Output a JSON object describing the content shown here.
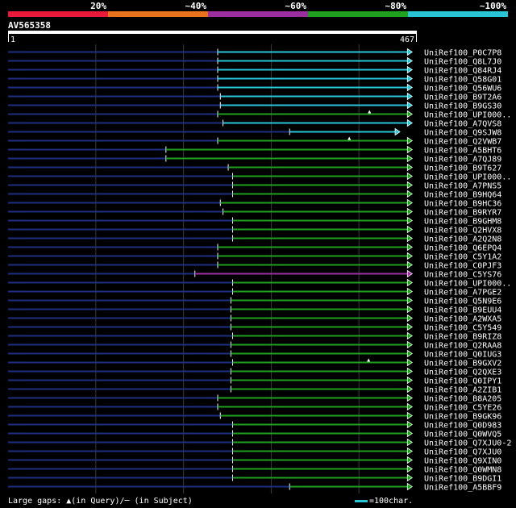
{
  "identity_legend": [
    {
      "label": "20%",
      "color": "#e8193a"
    },
    {
      "label": "~40%",
      "color": "#e8731c"
    },
    {
      "label": "~60%",
      "color": "#9b2fa0"
    },
    {
      "label": "~80%",
      "color": "#1fa01f"
    },
    {
      "label": "~100%",
      "color": "#29c5d6"
    }
  ],
  "query": {
    "name": "AV565358",
    "start_label": "1",
    "end_label": "467"
  },
  "footer": {
    "gaps_text": "Large gaps: ▲(in Query)/─ (in Subject)",
    "scale_text": "=100char."
  },
  "chart_data": {
    "type": "alignment",
    "query_length": 467,
    "hits": [
      {
        "name": "UniRef100_P0C7P8",
        "start": 240,
        "end": 459,
        "color": "#29c5d6",
        "gap": null
      },
      {
        "name": "UniRef100_Q8L7J0",
        "start": 240,
        "end": 459,
        "color": "#29c5d6",
        "gap": null
      },
      {
        "name": "UniRef100_Q84RJ4",
        "start": 240,
        "end": 459,
        "color": "#29c5d6",
        "gap": null
      },
      {
        "name": "UniRef100_Q58G01",
        "start": 240,
        "end": 459,
        "color": "#29c5d6",
        "gap": null
      },
      {
        "name": "UniRef100_Q56WU6",
        "start": 240,
        "end": 459,
        "color": "#29c5d6",
        "gap": null
      },
      {
        "name": "UniRef100_B9T2A6",
        "start": 243,
        "end": 459,
        "color": "#29c5d6",
        "gap": null
      },
      {
        "name": "UniRef100_B9GS30",
        "start": 243,
        "end": 459,
        "color": "#29c5d6",
        "gap": null
      },
      {
        "name": "UniRef100_UPI000..",
        "start": 240,
        "end": 459,
        "color": "#1fa01f",
        "gap": 413
      },
      {
        "name": "UniRef100_A7QVS8",
        "start": 246,
        "end": 459,
        "color": "#29c5d6",
        "gap": null
      },
      {
        "name": "UniRef100_Q9SJW8",
        "start": 322,
        "end": 445,
        "color": "#29c5d6",
        "gap": null
      },
      {
        "name": "UniRef100_Q2VWB7",
        "start": 240,
        "end": 459,
        "color": "#1fa01f",
        "gap": 390
      },
      {
        "name": "UniRef100_A5BHT6",
        "start": 181,
        "end": 459,
        "color": "#1fa01f",
        "gap": null
      },
      {
        "name": "UniRef100_A7QJ89",
        "start": 181,
        "end": 459,
        "color": "#1fa01f",
        "gap": null
      },
      {
        "name": "UniRef100_B9T627",
        "start": 252,
        "end": 459,
        "color": "#1fa01f",
        "gap": null
      },
      {
        "name": "UniRef100_UPI000..",
        "start": 257,
        "end": 459,
        "color": "#1fa01f",
        "gap": null
      },
      {
        "name": "UniRef100_A7PNS5",
        "start": 257,
        "end": 459,
        "color": "#1fa01f",
        "gap": null
      },
      {
        "name": "UniRef100_B9HQ64",
        "start": 257,
        "end": 459,
        "color": "#1fa01f",
        "gap": null
      },
      {
        "name": "UniRef100_B9HC36",
        "start": 243,
        "end": 459,
        "color": "#1fa01f",
        "gap": null
      },
      {
        "name": "UniRef100_B9RYR7",
        "start": 246,
        "end": 459,
        "color": "#1fa01f",
        "gap": null
      },
      {
        "name": "UniRef100_B9GHM8",
        "start": 257,
        "end": 459,
        "color": "#1fa01f",
        "gap": null
      },
      {
        "name": "UniRef100_Q2HVX8",
        "start": 257,
        "end": 459,
        "color": "#1fa01f",
        "gap": null
      },
      {
        "name": "UniRef100_A2Q2N8",
        "start": 257,
        "end": 459,
        "color": "#1fa01f",
        "gap": null
      },
      {
        "name": "UniRef100_Q6EPQ4",
        "start": 240,
        "end": 459,
        "color": "#1fa01f",
        "gap": null
      },
      {
        "name": "UniRef100_C5Y1A2",
        "start": 240,
        "end": 459,
        "color": "#1fa01f",
        "gap": null
      },
      {
        "name": "UniRef100_C0PJF3",
        "start": 240,
        "end": 459,
        "color": "#1fa01f",
        "gap": null
      },
      {
        "name": "UniRef100_C5YS76",
        "start": 214,
        "end": 459,
        "color": "#9b2fa0",
        "gap": null
      },
      {
        "name": "UniRef100_UPI000..",
        "start": 257,
        "end": 459,
        "color": "#1fa01f",
        "gap": null
      },
      {
        "name": "UniRef100_A7PGE2",
        "start": 257,
        "end": 459,
        "color": "#1fa01f",
        "gap": null
      },
      {
        "name": "UniRef100_Q5N9E6",
        "start": 255,
        "end": 459,
        "color": "#1fa01f",
        "gap": null
      },
      {
        "name": "UniRef100_B9EUU4",
        "start": 255,
        "end": 459,
        "color": "#1fa01f",
        "gap": null
      },
      {
        "name": "UniRef100_A2WXA5",
        "start": 255,
        "end": 459,
        "color": "#1fa01f",
        "gap": null
      },
      {
        "name": "UniRef100_C5Y549",
        "start": 255,
        "end": 459,
        "color": "#1fa01f",
        "gap": null
      },
      {
        "name": "UniRef100_B9RIZ8",
        "start": 257,
        "end": 459,
        "color": "#1fa01f",
        "gap": null
      },
      {
        "name": "UniRef100_Q2RAA8",
        "start": 255,
        "end": 459,
        "color": "#1fa01f",
        "gap": null
      },
      {
        "name": "UniRef100_Q0IUG3",
        "start": 255,
        "end": 459,
        "color": "#1fa01f",
        "gap": null
      },
      {
        "name": "UniRef100_B9GXV2",
        "start": 257,
        "end": 459,
        "color": "#1fa01f",
        "gap": 412
      },
      {
        "name": "UniRef100_Q2QXE3",
        "start": 255,
        "end": 459,
        "color": "#1fa01f",
        "gap": null
      },
      {
        "name": "UniRef100_Q0IPY1",
        "start": 255,
        "end": 459,
        "color": "#1fa01f",
        "gap": null
      },
      {
        "name": "UniRef100_A2ZIB1",
        "start": 255,
        "end": 459,
        "color": "#1fa01f",
        "gap": null
      },
      {
        "name": "UniRef100_B8A205",
        "start": 240,
        "end": 459,
        "color": "#1fa01f",
        "gap": null
      },
      {
        "name": "UniRef100_C5YE26",
        "start": 240,
        "end": 459,
        "color": "#1fa01f",
        "gap": null
      },
      {
        "name": "UniRef100_B9GK96",
        "start": 243,
        "end": 459,
        "color": "#1fa01f",
        "gap": null
      },
      {
        "name": "UniRef100_Q0D983",
        "start": 257,
        "end": 459,
        "color": "#1fa01f",
        "gap": null
      },
      {
        "name": "UniRef100_Q0WVQ5",
        "start": 257,
        "end": 459,
        "color": "#1fa01f",
        "gap": null
      },
      {
        "name": "UniRef100_Q7XJU0-2",
        "start": 257,
        "end": 459,
        "color": "#1fa01f",
        "gap": null
      },
      {
        "name": "UniRef100_Q7XJU0",
        "start": 257,
        "end": 459,
        "color": "#1fa01f",
        "gap": null
      },
      {
        "name": "UniRef100_Q9XIN0",
        "start": 257,
        "end": 459,
        "color": "#1fa01f",
        "gap": null
      },
      {
        "name": "UniRef100_Q0WMN8",
        "start": 257,
        "end": 459,
        "color": "#1fa01f",
        "gap": null
      },
      {
        "name": "UniRef100_B9DGI1",
        "start": 257,
        "end": 459,
        "color": "#1fa01f",
        "gap": null
      },
      {
        "name": "UniRef100_A5BBF9",
        "start": 322,
        "end": 459,
        "color": "#1fa01f",
        "gap": null
      }
    ]
  }
}
